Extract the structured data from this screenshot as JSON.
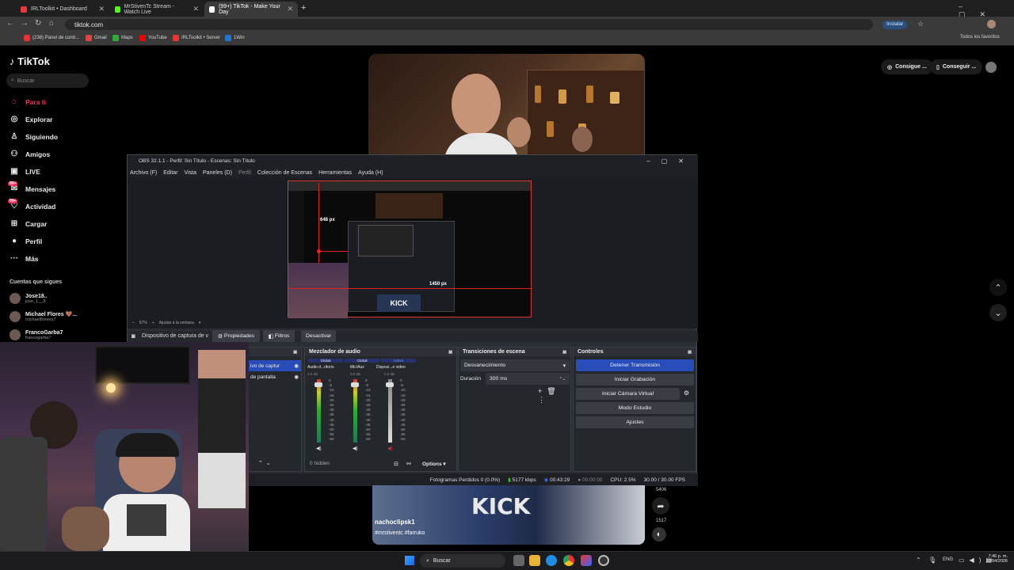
{
  "browser": {
    "tabs": [
      {
        "title": "IRLToolkit • Dashboard",
        "color": "#e33b3b"
      },
      {
        "title": "MrStivenTc Stream - Watch Live",
        "color": "#53fc18"
      },
      {
        "title": "(99+) TikTok - Make Your Day",
        "color": "#ffffff"
      }
    ],
    "url": "tiktok.com",
    "install_label": "Instalar",
    "bookmarks": [
      "(238) Panel de contr...",
      "Gmail",
      "Maps",
      "YouTube",
      "IRLToolkit • Server",
      "1Win"
    ],
    "all_bookmarks": "Todos los favoritos"
  },
  "tiktok": {
    "logo": "TikTok",
    "search_placeholder": "Buscar",
    "nav": [
      {
        "label": "Para ti",
        "icon": "home-icon"
      },
      {
        "label": "Explorar",
        "icon": "compass-icon"
      },
      {
        "label": "Siguiendo",
        "icon": "following-icon"
      },
      {
        "label": "Amigos",
        "icon": "friends-icon"
      },
      {
        "label": "LIVE",
        "icon": "live-icon"
      },
      {
        "label": "Mensajes",
        "icon": "message-icon",
        "badge": "99+"
      },
      {
        "label": "Actividad",
        "icon": "activity-icon",
        "badge": "99+"
      },
      {
        "label": "Cargar",
        "icon": "upload-icon"
      },
      {
        "label": "Perfil",
        "icon": "profile-icon"
      },
      {
        "label": "Más",
        "icon": "more-icon"
      }
    ],
    "following_heading": "Cuentas que sigues",
    "following": [
      {
        "name": "Jose18..",
        "handle": "jose_1__8"
      },
      {
        "name": "Michael Flores 🤎...",
        "handle": "michaelflorees7"
      },
      {
        "name": "FrancoGarba7",
        "handle": "francogarba7"
      }
    ],
    "topright": [
      "Consigue ...",
      "Conseguir ..."
    ],
    "video_user": "nachoclipsk1",
    "video_tags": "#mrstiventc #farruko",
    "share_count": "5406",
    "other_count": "1517",
    "accent": "#fe2c55"
  },
  "obs": {
    "title": "OBS 32.1.1 - Perfil: Sin Título - Escenas: Sin Título",
    "menu": [
      "Archivo (F)",
      "Editar",
      "Vista",
      "Paneles (D)",
      "Perfil",
      "Colección de Escenas",
      "Herramientas",
      "Ayuda (H)"
    ],
    "zoom": "67%",
    "fit_label": "Ajustar a la ventana",
    "preview_label_w": "648 px",
    "preview_label_h": "1450 px",
    "source_name": "Dispositivo de captura de v",
    "properties": "Propiedades",
    "filters": "Filtros",
    "deactivate": "Desactivar",
    "sources": [
      "ivo de captur",
      "de pantalla"
    ],
    "mixer_title": "Mezclador de audio",
    "mixer_channels": [
      {
        "tag": "Global",
        "name": "Audio d...ritorio",
        "db": "0.0 dB"
      },
      {
        "tag": "Global",
        "name": "Mic/Aux",
        "db": "0.0 dB"
      },
      {
        "tag": "Activo",
        "name": "Disposi...e video",
        "db": "0.0 dB"
      }
    ],
    "meter_ticks": [
      "0",
      "-5",
      "-10",
      "-15",
      "-20",
      "-25",
      "-30",
      "-35",
      "-40",
      "-45",
      "-50",
      "-55",
      "-60"
    ],
    "hidden": "0 hidden",
    "options": "Options",
    "transitions_title": "Transiciones de escena",
    "transition": "Desvanecimiento",
    "duration_label": "Duración",
    "duration": "300 ms",
    "controls_title": "Controles",
    "controls": [
      "Detener Transmisión",
      "Iniciar Grabación",
      "Iniciar Cámara Virtual",
      "Modo Estudio",
      "Ajustes"
    ],
    "status": {
      "dropped": "Fotogramas Perdidos 0 (0.0%)",
      "bitrate": "5177 kbps",
      "live_time": "00:43:29",
      "rec_time": "00:00:00",
      "cpu": "CPU: 2.5%",
      "fps": "30.00 / 30.00 FPS"
    },
    "accent": "#284cb8"
  },
  "taskbar": {
    "search": "Buscar",
    "lang": "ENG",
    "time": "7:46 p. m.",
    "date": "22/04/2026"
  }
}
